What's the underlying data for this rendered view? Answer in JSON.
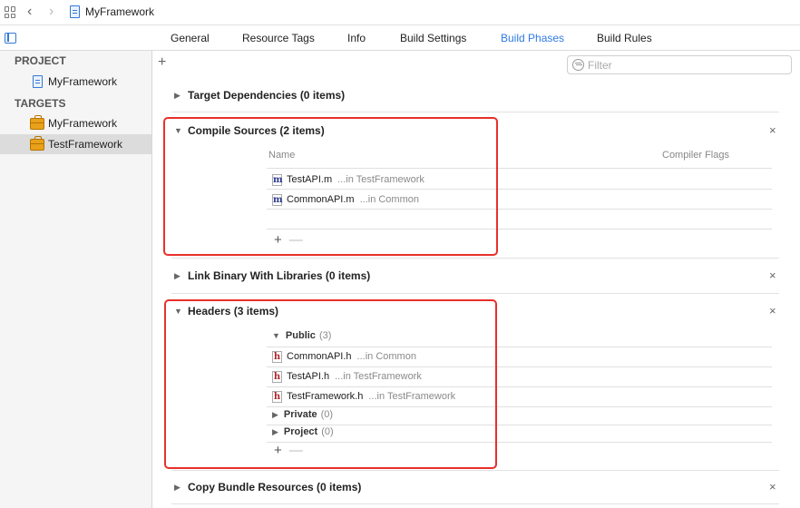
{
  "titlebar": {
    "title": "MyFramework"
  },
  "tabs": [
    {
      "label": "General"
    },
    {
      "label": "Resource Tags"
    },
    {
      "label": "Info"
    },
    {
      "label": "Build Settings"
    },
    {
      "label": "Build Phases",
      "active": true
    },
    {
      "label": "Build Rules"
    }
  ],
  "sidebar": {
    "project_header": "PROJECT",
    "project_item": "MyFramework",
    "targets_header": "TARGETS",
    "targets": [
      {
        "label": "MyFramework"
      },
      {
        "label": "TestFramework",
        "selected": true
      }
    ]
  },
  "filter": {
    "placeholder": "Filter",
    "value": ""
  },
  "phases": {
    "target_dependencies": {
      "title": "Target Dependencies (0 items)"
    },
    "compile_sources": {
      "title": "Compile Sources (2 items)",
      "col_name": "Name",
      "col_flags": "Compiler Flags",
      "files": [
        {
          "icon": "m",
          "name": "TestAPI.m",
          "location": "...in TestFramework"
        },
        {
          "icon": "m",
          "name": "CommonAPI.m",
          "location": "...in Common"
        }
      ]
    },
    "link_binary": {
      "title": "Link Binary With Libraries (0 items)"
    },
    "headers": {
      "title": "Headers (3 items)",
      "public": {
        "name": "Public",
        "count": "(3)"
      },
      "files": [
        {
          "icon": "h",
          "name": "CommonAPI.h",
          "location": "...in Common"
        },
        {
          "icon": "h",
          "name": "TestAPI.h",
          "location": "...in TestFramework"
        },
        {
          "icon": "h",
          "name": "TestFramework.h",
          "location": "...in TestFramework"
        }
      ],
      "private": {
        "name": "Private",
        "count": "(0)"
      },
      "project": {
        "name": "Project",
        "count": "(0)"
      }
    },
    "copy_bundle": {
      "title": "Copy Bundle Resources (0 items)"
    }
  },
  "glyphs": {
    "plus": "+",
    "minus": "—",
    "close": "×",
    "expanded": "▼",
    "collapsed": "▶"
  },
  "colors": {
    "accent": "#2f7ae5",
    "highlight_box": "#e8302a",
    "target_icon": "#e9a11b"
  }
}
